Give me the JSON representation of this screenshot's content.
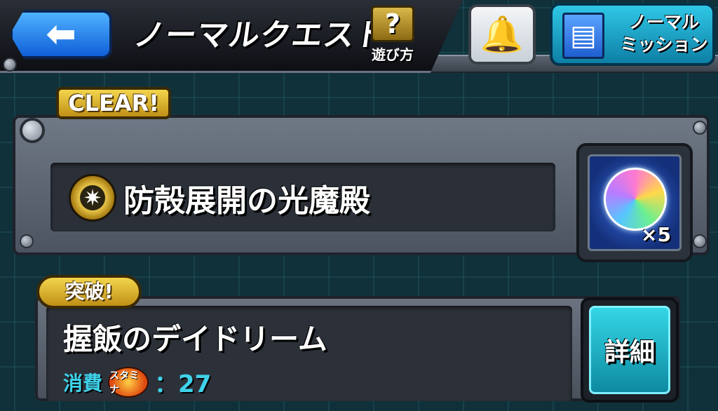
{
  "header": {
    "back_icon": "arrow-left-icon",
    "title": "ノーマルクエスト",
    "help": {
      "icon": "?",
      "label": "遊び方"
    },
    "bell_icon": "bell-icon",
    "mission": {
      "icon": "book-icon",
      "line1": "ノーマル",
      "line2": "ミッション"
    }
  },
  "quests": [
    {
      "status_badge": "CLEAR!",
      "element_icon": "light-element-icon",
      "name": "防殻展開の光魔殿",
      "reward": {
        "icon": "rainbow-orb-icon",
        "count": "×5"
      }
    },
    {
      "status_badge": "突破!",
      "name": "握飯のデイドリーム",
      "cost_label": "消費",
      "stamina_label": "スタミナ",
      "stamina_value": "：27",
      "detail_label": "詳細"
    }
  ],
  "colors": {
    "accent_cyan": "#3fd2ea",
    "gold": "#e3b832",
    "back_blue": "#1f7be8"
  }
}
